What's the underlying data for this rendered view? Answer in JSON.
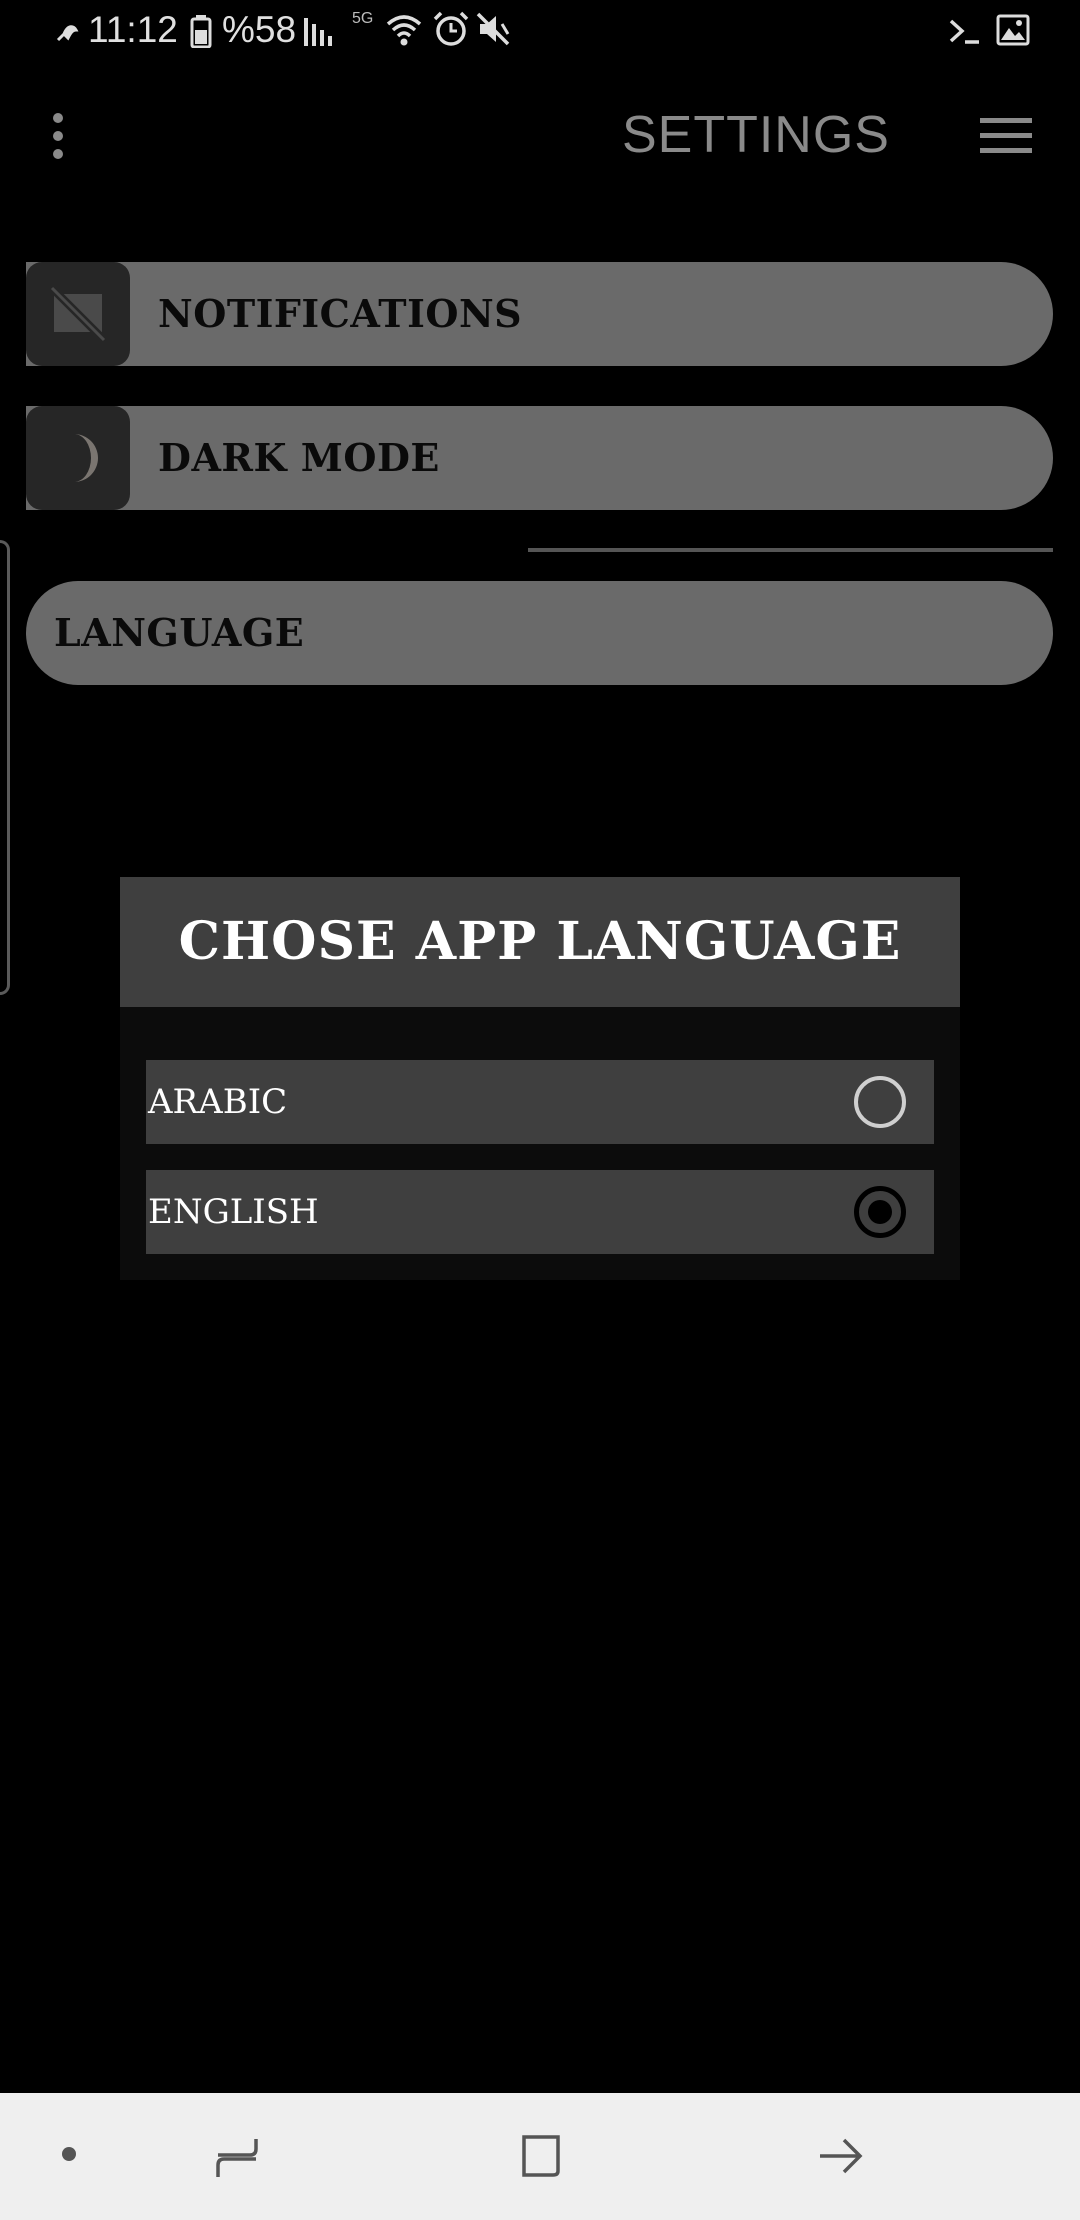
{
  "status_bar": {
    "time": "11:12",
    "battery": "%58",
    "network": "5G",
    "icons": [
      "fountain-pen-icon",
      "battery-icon",
      "signal-icon",
      "wifi-icon",
      "alarm-icon",
      "mute-icon",
      "terminal-icon",
      "image-icon"
    ]
  },
  "toolbar": {
    "title": "SETTINGS",
    "overflow_icon": "more-vertical-icon",
    "menu_icon": "hamburger-menu-icon"
  },
  "settings": {
    "notifications": {
      "label": "NOTIFICATIONS",
      "icon": "notifications-off-icon"
    },
    "dark_mode": {
      "label": "DARK MODE",
      "icon": "moon-icon"
    },
    "language": {
      "label": "LANGUAGE"
    }
  },
  "dialog": {
    "title": "CHOSE APP LANGUAGE",
    "options": [
      {
        "label": "ARABIC",
        "selected": false
      },
      {
        "label": "ENGLISH",
        "selected": true
      }
    ]
  },
  "navbar": {
    "items": [
      "dot-icon",
      "recent-apps-icon",
      "home-icon",
      "back-icon"
    ]
  },
  "colors": {
    "background": "#000000",
    "row": "#6a6a6a",
    "dialog_header": "#3f3f3f",
    "navbar": "#efefef"
  }
}
